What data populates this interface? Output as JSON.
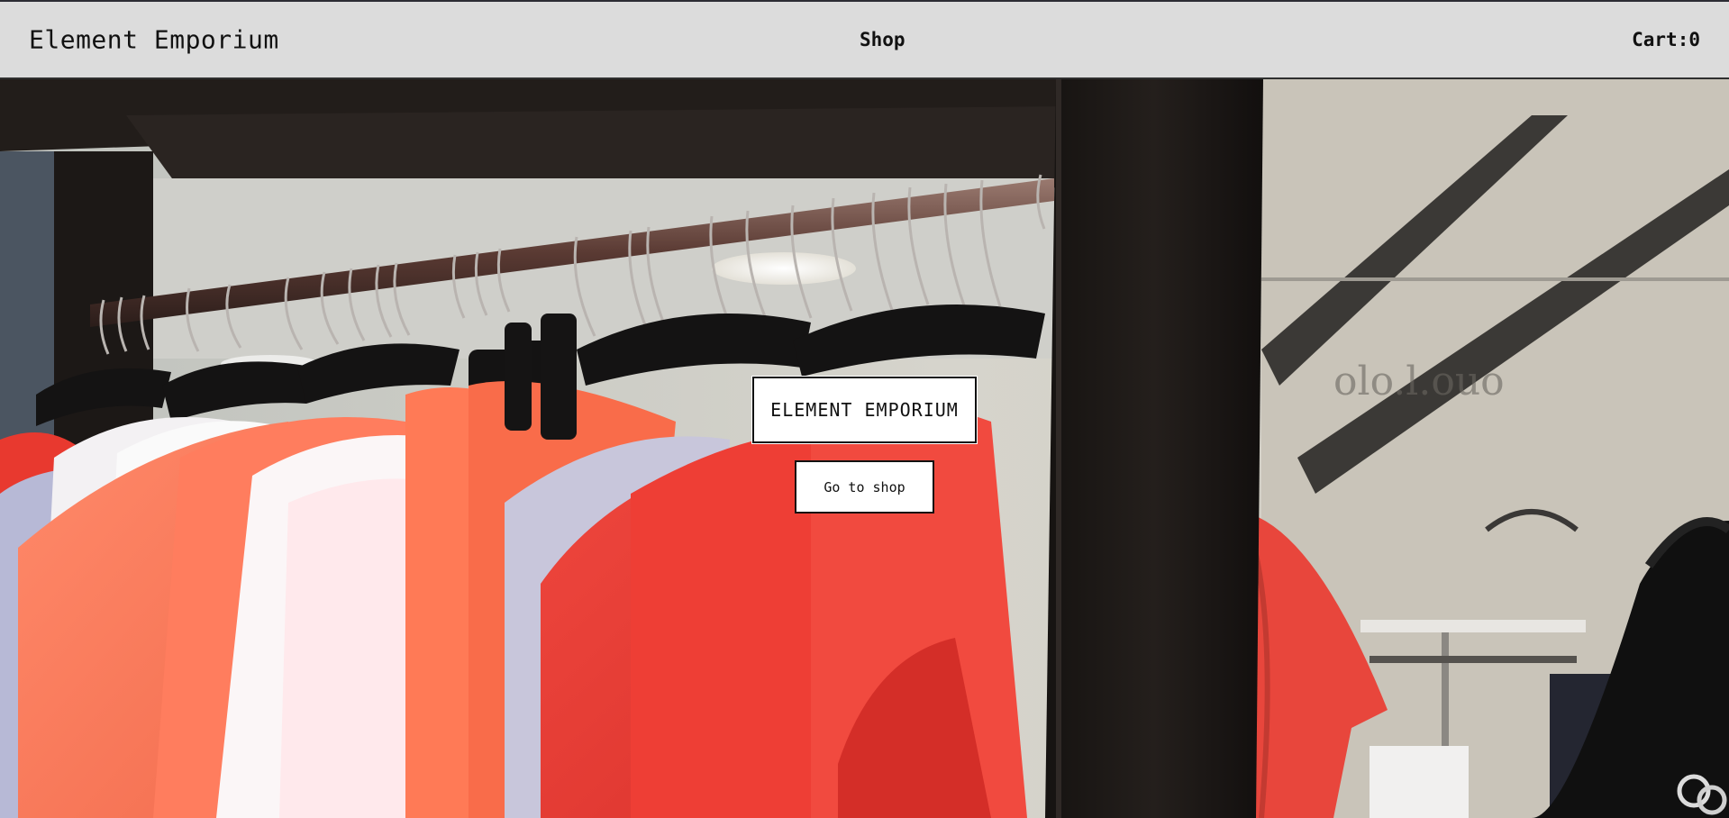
{
  "header": {
    "brand": "Element Emporium",
    "nav_shop": "Shop",
    "cart_label": "Cart:",
    "cart_count": "0"
  },
  "hero": {
    "title": "ELEMENT EMPORIUM",
    "cta_label": "Go to shop",
    "image_icon": "clothing-rack-photo"
  },
  "colors": {
    "header_bg": "#dcdcdc",
    "text": "#111111",
    "box_bg": "#ffffff"
  }
}
